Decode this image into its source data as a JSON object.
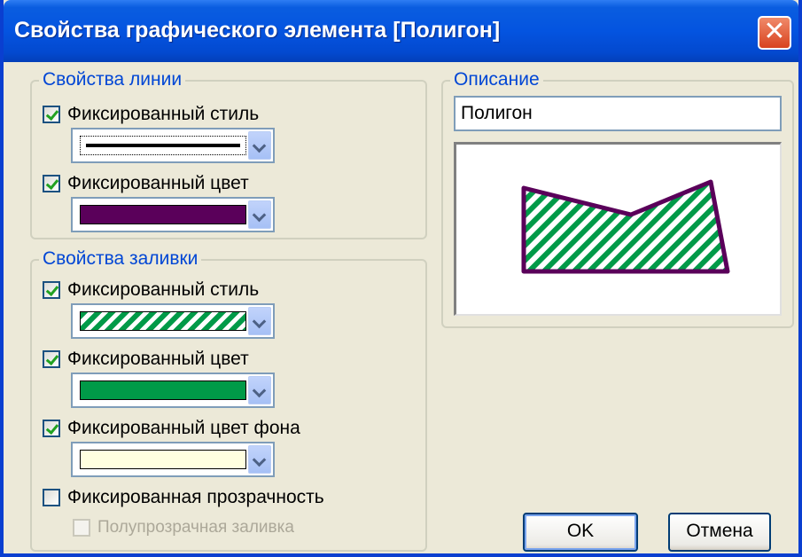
{
  "window": {
    "title": "Свойства графического элемента [Полигон]"
  },
  "line_props": {
    "legend": "Свойства линии",
    "fixed_style": {
      "label": "Фиксированный стиль",
      "checked": true
    },
    "fixed_color": {
      "label": "Фиксированный цвет",
      "checked": true,
      "color": "#5a005a"
    }
  },
  "fill_props": {
    "legend": "Свойства заливки",
    "fixed_style": {
      "label": "Фиксированный стиль",
      "checked": true
    },
    "fixed_color": {
      "label": "Фиксированный цвет",
      "checked": true,
      "color": "#009a48"
    },
    "fixed_bg_color": {
      "label": "Фиксированный цвет фона",
      "checked": true,
      "color": "#ffffe0"
    },
    "fixed_transparency": {
      "label": "Фиксированная прозрачность",
      "checked": false
    },
    "semi_transparent": {
      "label": "Полупрозрачная заливка",
      "checked": false,
      "enabled": false
    }
  },
  "description": {
    "legend": "Описание",
    "value": "Полигон"
  },
  "buttons": {
    "ok": "OK",
    "cancel": "Отмена"
  },
  "icons": {
    "close": "close-icon",
    "dropdown": "chevron-down-icon",
    "check": "checkmark-icon"
  },
  "colors": {
    "accent": "#0046d5",
    "title_bar": "#0454e0",
    "line": "#5a005a",
    "fill": "#009a48"
  }
}
